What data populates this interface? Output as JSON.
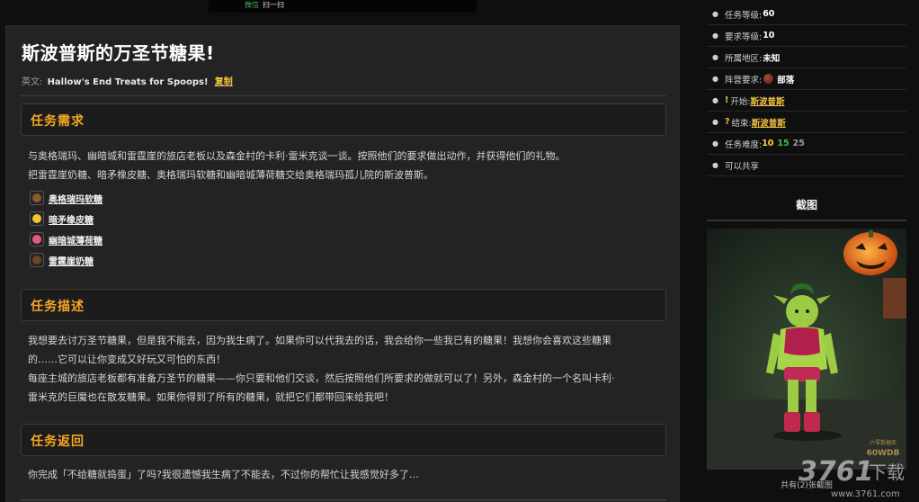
{
  "banner": {
    "wechat": "微信",
    "scan": "扫一扫"
  },
  "quest": {
    "title": "斯波普斯的万圣节糖果!",
    "en_label": "英文:",
    "en_name": "Hallow's End Treats for Spoops!",
    "copy_label": "复制"
  },
  "sections": {
    "requirements": {
      "heading": "任务需求",
      "lines": [
        "与奥格瑞玛、幽暗城和雷霆崖的旅店老板以及森金村的卡利·雷米克谈一谈。按照他们的要求做出动作，并获得他们的礼物。",
        "把雷霆崖奶糖、暗矛橡皮糖、奥格瑞玛软糖和幽暗城薄荷糖交给奥格瑞玛孤儿院的斯波普斯。"
      ],
      "items": [
        {
          "name": "奥格瑞玛软糖",
          "color": "#8a5a2b"
        },
        {
          "name": "暗矛橡皮糖",
          "color": "#f2c530"
        },
        {
          "name": "幽暗城薄荷糖",
          "color": "#e65a7a"
        },
        {
          "name": "雷霆崖奶糖",
          "color": "#6b4420"
        }
      ]
    },
    "description": {
      "heading": "任务描述",
      "lines": [
        "我想要去讨万圣节糖果，但是我不能去，因为我生病了。如果你可以代我去的话，我会给你一些我已有的糖果！我想你会喜欢这些糖果",
        "的……它可以让你变成又好玩又可怕的东西！",
        "每座主城的旅店老板都有准备万圣节的糖果——你只要和他们交谈，然后按照他们所要求的做就可以了！另外，森金村的一个名叫卡利·",
        "雷米克的巨魔也在散发糖果。如果你得到了所有的糖果，就把它们都带回来给我吧！"
      ]
    },
    "return": {
      "heading": "任务返回",
      "lines": [
        "你完成「不给糖就捣蛋」了吗?我很遗憾我生病了不能去，不过你的帮忙让我感觉好多了…"
      ]
    }
  },
  "sidebar": {
    "quest_level_label": "任务等级:",
    "quest_level": "60",
    "req_level_label": "要求等级:",
    "req_level": "10",
    "zone_label": "所属地区:",
    "zone": "未知",
    "faction_label": "阵营要求:",
    "faction": "部落",
    "start_label": "开始:",
    "start_npc": "斯波普斯",
    "end_label": "结束:",
    "end_npc": "斯波普斯",
    "difficulty_label": "任务难度:",
    "difficulty": [
      "10",
      "15",
      "25"
    ],
    "shareable": "可以共享",
    "screenshots_heading": "截图",
    "screenshot_count": "共有(2)张截图",
    "screenshot_watermark": "六零数据库",
    "screenshot_brand": "60WDB"
  },
  "watermark": {
    "brand": "3761",
    "suffix": "下载",
    "url": "www.3761.com"
  },
  "colors": {
    "accent": "#f5a623",
    "link": "#f0c040",
    "diff_green": "#3cc043",
    "diff_grey": "#9a9a9a"
  }
}
